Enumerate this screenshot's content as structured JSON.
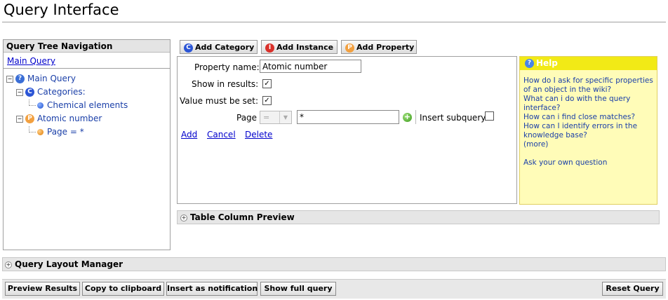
{
  "page_title": "Query Interface",
  "tree": {
    "header": "Query Tree Navigation",
    "main_link": "Main Query",
    "nodes": [
      {
        "label": "Main Query",
        "icon": "question-icon"
      },
      {
        "label": "Categories:",
        "icon": "category-icon"
      },
      {
        "label": "Chemical elements",
        "icon": "blue-dot-icon"
      },
      {
        "label": "Atomic number",
        "icon": "property-icon"
      },
      {
        "label": "Page = *",
        "icon": "orange-dot-icon"
      }
    ]
  },
  "add_buttons": {
    "category": "Add Category",
    "instance": "Add Instance",
    "property": "Add Property"
  },
  "editor": {
    "property_name_label": "Property name:",
    "property_name_value": "Atomic number",
    "show_in_results_label": "Show in results:",
    "show_in_results": true,
    "value_must_be_set_label": "Value must be set:",
    "value_must_be_set": true,
    "page_label": "Page",
    "operator": "=",
    "value": "*",
    "insert_subquery_label": "Insert subquery",
    "insert_subquery": false,
    "links": {
      "add": "Add",
      "cancel": "Cancel",
      "delete": "Delete"
    }
  },
  "help": {
    "title": "Help",
    "links": [
      "How do I ask for specific properties of an object in the wiki?",
      "What can i do with the query interface?",
      "How can i find close matches?",
      "How can I identify errors in the knowledge base?",
      "(more)"
    ],
    "ask_link": "Ask your own question"
  },
  "sections": {
    "table_preview": "Table Column Preview",
    "layout_manager": "Query Layout Manager"
  },
  "bottom_buttons": {
    "preview": "Preview Results",
    "copy": "Copy to clipboard",
    "notify": "Insert as notification",
    "show_full": "Show full query",
    "reset": "Reset Query"
  },
  "colors": {
    "help_header": "#f2ea16",
    "help_bg": "#fffcb8",
    "link": "#0000cc"
  }
}
